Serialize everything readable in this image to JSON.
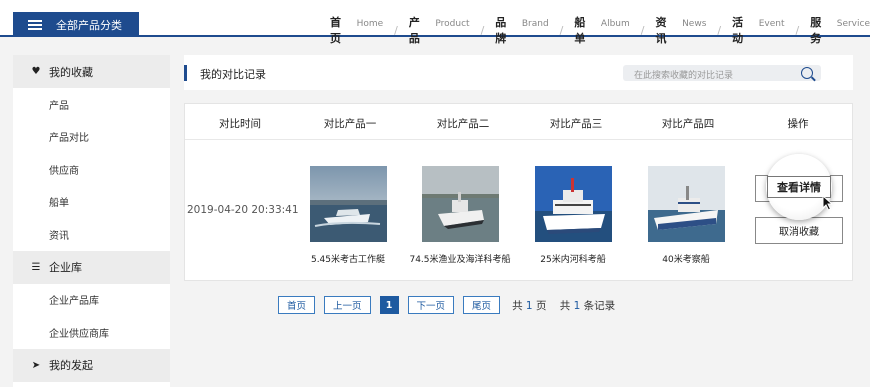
{
  "header": {
    "category_button": "全部产品分类",
    "nav": [
      {
        "cn": "首页",
        "en": "Home"
      },
      {
        "cn": "产品",
        "en": "Product"
      },
      {
        "cn": "品牌",
        "en": "Brand"
      },
      {
        "cn": "船单",
        "en": "Album"
      },
      {
        "cn": "资讯",
        "en": "News"
      },
      {
        "cn": "活动",
        "en": "Event"
      },
      {
        "cn": "服务",
        "en": "Service"
      }
    ]
  },
  "sidebar": {
    "groups": [
      {
        "label": "我的收藏",
        "icon": "heart-icon",
        "items": [
          "产品",
          "产品对比",
          "供应商",
          "船单",
          "资讯"
        ]
      },
      {
        "label": "企业库",
        "icon": "list-icon",
        "items": [
          "企业产品库",
          "企业供应商库"
        ]
      },
      {
        "label": "我的发起",
        "icon": "send-icon",
        "items": []
      }
    ]
  },
  "main": {
    "title": "我的对比记录",
    "search_placeholder": "在此搜索收藏的对比记录",
    "columns": [
      "对比时间",
      "对比产品一",
      "对比产品二",
      "对比产品三",
      "对比产品四",
      "操作"
    ],
    "row": {
      "time": "2019-04-20 20:33:41",
      "products": [
        "5.45米考古工作艇",
        "74.5米渔业及海洋科考船",
        "25米内河科考船",
        "40米考察船"
      ],
      "actions": {
        "detail": "查看详情",
        "cancel": "取消收藏"
      }
    }
  },
  "pagination": {
    "first": "首页",
    "prev": "上一页",
    "current": "1",
    "next": "下一页",
    "last": "尾页",
    "total_pages_prefix": "共",
    "total_pages": "1",
    "total_pages_suffix": "页",
    "total_records_prefix": "共",
    "total_records": "1",
    "total_records_suffix": "条记录"
  },
  "colors": {
    "brand": "#1e4b8e",
    "link": "#1e5aa0"
  }
}
